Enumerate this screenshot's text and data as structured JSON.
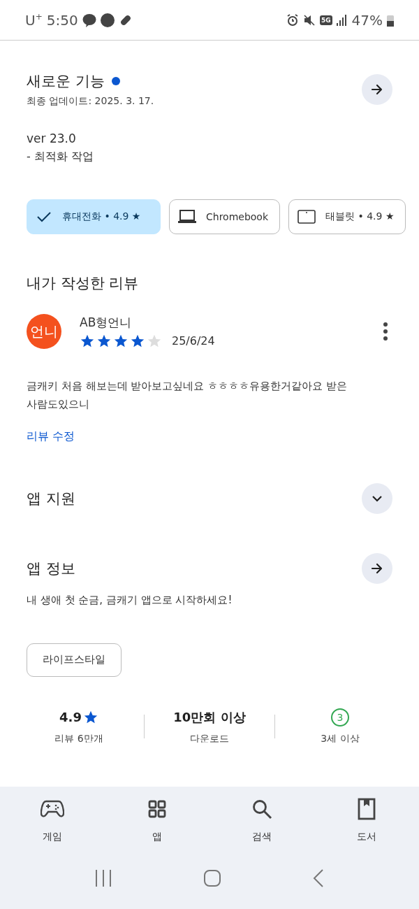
{
  "status_bar": {
    "carrier": "U$^{+}$",
    "time": "5:50",
    "network": "5G",
    "battery": "47%"
  },
  "whats_new": {
    "title": "새로운 기능",
    "unread": true,
    "updated": "최종 업데이트: 2025. 3. 17.",
    "version": "ver 23.0",
    "notes": "- 최적화 작업"
  },
  "device_chips": [
    {
      "kind": "phone",
      "label": "휴대전화 • 4.9 ★",
      "selected": true
    },
    {
      "kind": "laptop",
      "label": "Chromebook",
      "selected": false
    },
    {
      "kind": "tablet",
      "label": "태블릿 • 4.9 ★",
      "selected": false
    }
  ],
  "my_review": {
    "heading": "내가 작성한 리뷰",
    "avatar": "언니",
    "author": "AB형언니",
    "stars": 4,
    "date": "25/6/24",
    "text": "금캐키 처음 해보는데 받아보고싶네요 ㅎㅎㅎㅎ유용한거같아요 받은사람도있으니",
    "edit_link": "리뷰 수정"
  },
  "app_support": {
    "title": "앱 지원",
    "expanded": false
  },
  "app_info": {
    "title": "앱 정보",
    "description": "내 생애 첫 순금, 금캐기 앱으로 시작하세요!",
    "category": "라이프스타일"
  },
  "stats": [
    {
      "kind": "rating",
      "value": "4.9",
      "label": "리뷰 6만개"
    },
    {
      "kind": "downloads",
      "value": "10만회 이상",
      "label": "다운로드"
    },
    {
      "kind": "age",
      "value": "3",
      "label": "3세 이상"
    }
  ],
  "bottom_nav": [
    {
      "kind": "games",
      "label": "게임"
    },
    {
      "kind": "apps",
      "label": "앱"
    },
    {
      "kind": "search",
      "label": "검색"
    },
    {
      "kind": "books",
      "label": "도서"
    }
  ]
}
